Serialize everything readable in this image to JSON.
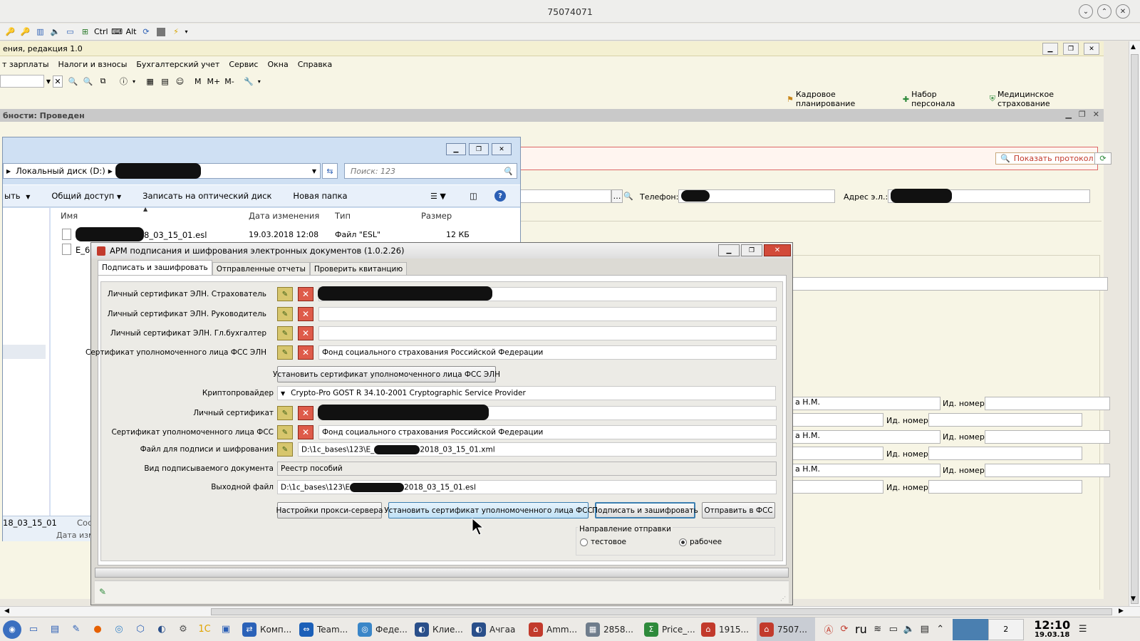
{
  "window": {
    "title": "75074071"
  },
  "rdp_toolbar": {
    "ctrl": "Ctrl",
    "alt": "Alt"
  },
  "app": {
    "title": "ения, редакция 1.0",
    "menu": [
      "т зарплаты",
      "Налоги и взносы",
      "Бухгалтерский учет",
      "Сервис",
      "Окна",
      "Справка"
    ],
    "toolbar_letters": [
      "M",
      "M+",
      "M-"
    ],
    "links": [
      "Кадровое планирование",
      "Набор персонала",
      "Медицинское страхование"
    ],
    "doc_title": "бности: Проведен",
    "show_protocol": "Показать протокол",
    "phone_label": "Телефон:",
    "email_label": "Адрес э.л.:",
    "rows": [
      {
        "name": "а Н.М.",
        "id_label": "Ид. номер:"
      },
      {
        "name": "",
        "id_label": "Ид. номер:"
      },
      {
        "name": "а Н.М.",
        "id_label": "Ид. номер:"
      },
      {
        "name": "",
        "id_label": "Ид. номер:"
      },
      {
        "name": "а Н.М.",
        "id_label": "Ид. номер:"
      },
      {
        "name": "",
        "id_label": "Ид. номер:"
      }
    ]
  },
  "explorer": {
    "path": [
      "Локальный диск (D:)"
    ],
    "search_placeholder": "Поиск: 123",
    "commands": [
      "ыть",
      "Общий доступ",
      "Записать на оптический диск",
      "Новая папка"
    ],
    "columns": [
      "Имя",
      "Дата изменения",
      "Тип",
      "Размер"
    ],
    "files": [
      {
        "name": "8_03_15_01.esl",
        "date": "19.03.2018 12:08",
        "type": "Файл \"ESL\"",
        "size": "12 КБ"
      },
      {
        "name": "E_61",
        "date": "",
        "type": "",
        "size": ""
      }
    ],
    "details_name": "18_03_15_01",
    "details_meta": "Сос",
    "details_date": "Дата изм"
  },
  "arm": {
    "title": "АРМ подписания и шифрования электронных документов (1.0.2.26)",
    "tabs": [
      "Подписать и зашифровать",
      "Отправленные отчеты",
      "Проверить квитанцию"
    ],
    "cert_rows": [
      {
        "label": "Личный сертификат ЭЛН. Страхователь",
        "value": ""
      },
      {
        "label": "Личный сертификат ЭЛН. Руководитель",
        "value": ""
      },
      {
        "label": "Личный сертификат ЭЛН. Гл.бухгалтер",
        "value": ""
      },
      {
        "label": "Сертификат уполномоченного лица ФСС ЭЛН",
        "value": "Фонд социального страхования Российской Федерации"
      }
    ],
    "install_eln_button": "Установить сертификат уполномоченного лица ФСС ЭЛН",
    "crypto_label": "Криптопровайдер",
    "crypto_value": "Crypto-Pro GOST R 34.10-2001 Cryptographic Service Provider",
    "personal_cert_label": "Личный сертификат",
    "fss_cert_label": "Сертификат уполномоченного лица ФСС",
    "fss_cert_value": "Фонд социального страхования Российской Федерации",
    "file_label": "Файл для подписи и шифрования",
    "file_prefix": "D:\\1c_bases\\123\\E_",
    "file_suffix": "2018_03_15_01.xml",
    "doctype_label": "Вид подписываемого документа",
    "doctype_value": "Реестр пособий",
    "output_label": "Выходной файл",
    "output_prefix": "D:\\1c_bases\\123\\E",
    "output_suffix": "2018_03_15_01.esl",
    "buttons": {
      "proxy": "Настройки прокси-сервера",
      "install_fss": "Установить сертификат уполномоченного лица ФСС",
      "sign": "Подписать и зашифровать",
      "send": "Отправить в ФСС"
    },
    "direction_label": "Направление отправки",
    "direction_options": [
      "тестовое",
      "рабочее"
    ],
    "direction_selected": "рабочее"
  },
  "taskbar": {
    "tasks": [
      {
        "label": "Комп...",
        "icon": "window-arrows-icon",
        "color": "#2b62b8"
      },
      {
        "label": "Team...",
        "icon": "teamviewer-icon",
        "color": "#1b5fb8"
      },
      {
        "label": "Феде...",
        "icon": "browser-icon",
        "color": "#3a86c8"
      },
      {
        "label": "Клие...",
        "icon": "client-icon",
        "color": "#2a4f8a"
      },
      {
        "label": "Ачгаа",
        "icon": "client-icon",
        "color": "#2a4f8a"
      },
      {
        "label": "Amm...",
        "icon": "rdp-icon",
        "color": "#c23a2c"
      },
      {
        "label": "2858...",
        "icon": "spreadsheet-icon",
        "color": "#6f7d8c"
      },
      {
        "label": "Price_...",
        "icon": "sum-icon",
        "color": "#2e8a3b"
      },
      {
        "label": "1915...",
        "icon": "rdp-icon",
        "color": "#c23a2c"
      },
      {
        "label": "7507...",
        "icon": "rdp-icon",
        "color": "#c23a2c"
      }
    ],
    "language": "ru",
    "desktop_number": "2",
    "time": "12:10",
    "date": "19.03.18"
  }
}
